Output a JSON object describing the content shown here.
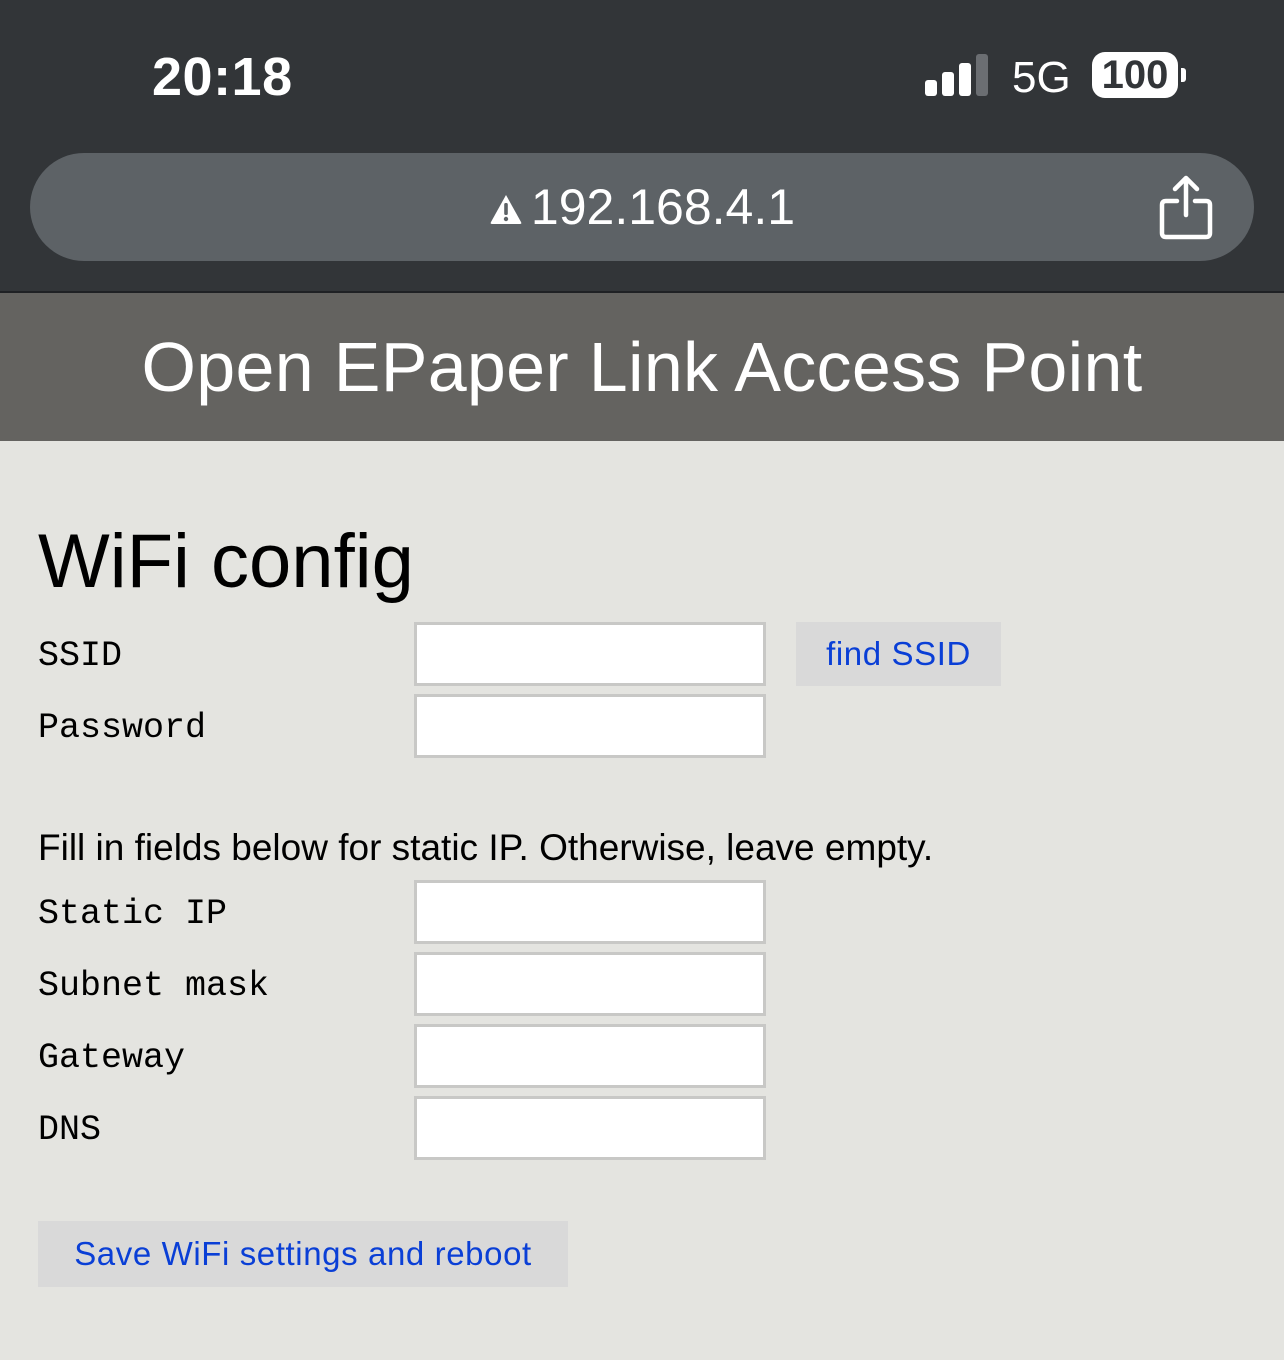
{
  "status_bar": {
    "time": "20:18",
    "network": "5G",
    "battery": "100",
    "signal_bars": 3,
    "signal_bars_total": 4
  },
  "browser": {
    "url": "192.168.4.1",
    "security_icon": "warning-icon",
    "share_icon": "share-icon"
  },
  "page": {
    "header": "Open EPaper Link Access Point",
    "section_title": "WiFi config",
    "ssid_label": "SSID",
    "ssid_value": "",
    "find_ssid_button": "find SSID",
    "password_label": "Password",
    "password_value": "",
    "static_ip_note": "Fill in fields below for static IP. Otherwise, leave empty.",
    "static_ip_label": "Static IP",
    "static_ip_value": "",
    "subnet_label": "Subnet mask",
    "subnet_value": "",
    "gateway_label": "Gateway",
    "gateway_value": "",
    "dns_label": "DNS",
    "dns_value": "",
    "save_button": "Save WiFi settings and reboot"
  },
  "colors": {
    "chrome_background": "#323538",
    "url_bar": "#5d6266",
    "header_background": "#646360",
    "page_background": "#e4e4e0",
    "button_background": "#d9d9d9",
    "button_text": "#0a3fd6"
  }
}
